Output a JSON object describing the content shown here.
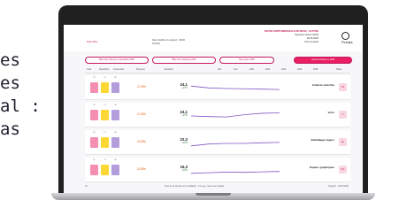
{
  "left_text": [
    "es",
    "es",
    "al :",
    "as"
  ],
  "app": {
    "title_lines": [
      "BILTAN SORTI MENSUELLE DE DEVIS - CLOTIVÉ",
      "Operation active (1000)",
      "29-09-2025",
      "Pour la saisie"
    ],
    "reference": "Devis filtre",
    "left_info": [
      "Date d'édition du rapport : 26/06",
      "Période"
    ],
    "logo_text": "Fluidys",
    "tabs": [
      {
        "label": "Bilan des collectes et répartition 2025",
        "active": false
      },
      {
        "label": "Bilan des matériaux 2025",
        "active": false
      },
      {
        "label": "Mes suites 2025",
        "active": false
      },
      {
        "label": "Aucune donnée en 2025",
        "active": true
      }
    ],
    "table_head": [
      "Total",
      "Répartition",
      "Contenants",
      "Moyenne",
      "Évolution",
      "Hier",
      "Jour",
      "2021",
      "2022",
      "2023",
      "2024",
      "2025",
      "Filière"
    ],
    "rows": [
      {
        "category": "Collecte sélective",
        "value": "24,1",
        "delta": "+17%",
        "pct": "-17,8%",
        "badge": "CS",
        "bars": [
          "#f48fb1",
          "#fdd835",
          "#b39ddb"
        ],
        "bar_labels": [
          "52",
          "21",
          "36"
        ],
        "trend": [
          0.7,
          0.55,
          0.5,
          0.48,
          0.45,
          0.42
        ]
      },
      {
        "category": "Verre",
        "value": "24,1",
        "delta": "+17%",
        "pct": "-17,8%",
        "badge": "V",
        "bars": [
          "#f48fb1",
          "#fdd835",
          "#b39ddb"
        ],
        "bar_labels": [
          "52",
          "21",
          "36"
        ],
        "trend": [
          0.5,
          0.45,
          0.42,
          0.6,
          0.72,
          0.75
        ]
      },
      {
        "category": "Emballages légers",
        "value": "22,3",
        "delta": "+12%",
        "pct": "-12,8%",
        "badge": "EL",
        "bars": [
          "#f48fb1",
          "#fdd835",
          "#b39ddb"
        ],
        "bar_labels": [
          "52",
          "21",
          "36"
        ],
        "trend": [
          0.3,
          0.45,
          0.5,
          0.5,
          0.55,
          0.58
        ]
      },
      {
        "category": "Papiers graphiques",
        "value": "15,3",
        "delta": "+12%",
        "pct": "-12,8%",
        "badge": "PG",
        "bars": [
          "#f48fb1",
          "#fdd835",
          "#b39ddb"
        ],
        "bar_labels": [
          "52",
          "21",
          "36"
        ],
        "trend": [
          0.3,
          0.35,
          0.4,
          0.38,
          0.42,
          0.45
        ]
      }
    ],
    "footer_left": "13",
    "footer_center": "Suivi de la mission de l'installation : 13 e-jeu, retour vers détails",
    "footer_right": "Rapport : 22/07/2025"
  }
}
